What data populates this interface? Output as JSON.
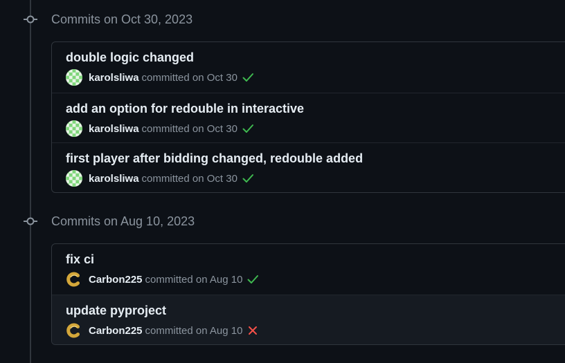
{
  "groups": [
    {
      "title": "Commits on Oct 30, 2023",
      "commits": [
        {
          "title": "double logic changed",
          "author": "karolsliwa",
          "meta": "committed on Oct 30",
          "status": "success"
        },
        {
          "title": "add an option for redouble in interactive",
          "author": "karolsliwa",
          "meta": "committed on Oct 30",
          "status": "success"
        },
        {
          "title": "first player after bidding changed, redouble added",
          "author": "karolsliwa",
          "meta": "committed on Oct 30",
          "status": "success"
        }
      ]
    },
    {
      "title": "Commits on Aug 10, 2023",
      "commits": [
        {
          "title": "fix ci",
          "author": "Carbon225",
          "meta": "committed on Aug 10",
          "status": "success"
        },
        {
          "title": "update pyproject",
          "author": "Carbon225",
          "meta": "committed on Aug 10",
          "status": "failure"
        }
      ]
    }
  ],
  "colors": {
    "success": "#3fb950",
    "failure": "#f85149",
    "identicon_green": "#7ed67a",
    "identicon_light": "#e8f5e6",
    "avatar_gold": "#d4a73a"
  },
  "icons": {
    "group_node": "git-commit-icon",
    "success": "check-icon",
    "failure": "x-icon",
    "avatar_karolsliwa": "identicon-avatar",
    "avatar_carbon225": "c-logo-avatar"
  }
}
